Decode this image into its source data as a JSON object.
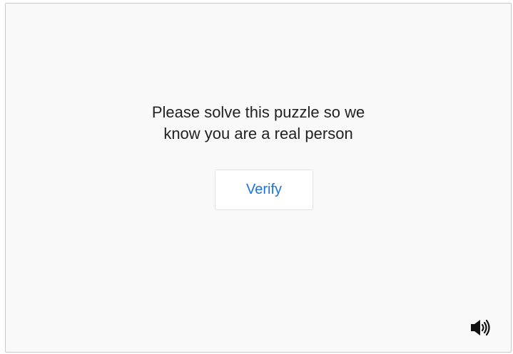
{
  "puzzle": {
    "prompt_line1": "Please solve this puzzle so we",
    "prompt_line2": "know you are a real person",
    "verify_label": "Verify",
    "audio_icon": "speaker-volume-icon",
    "accent_color": "#1a73d9"
  }
}
